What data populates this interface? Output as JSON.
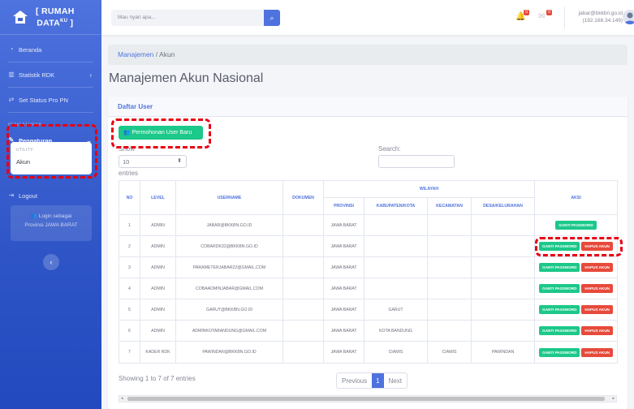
{
  "brand": {
    "line1": "[ RUMAH",
    "line2": "DATA",
    "sup": "KU",
    "line2_end": " ]"
  },
  "sidebar": {
    "items": [
      {
        "label": "Beranda",
        "icon": "gauge-icon"
      },
      {
        "label": "Statistik RDK",
        "icon": "chart-icon"
      },
      {
        "label": "Set Status Pro PN",
        "icon": "exchange-icon"
      }
    ],
    "heading": "PENGATURAN",
    "settings_label": "Pengaturan",
    "utility_heading": "UTILITY:",
    "akun_label": "Akun",
    "logout_label": "Logout",
    "login_line1": "Login sebagai",
    "login_line2": "Provinsi JAWA BARAT"
  },
  "topbar": {
    "search_placeholder": "Mau nyari apa...",
    "bell_badge": "0",
    "mail_badge": "0",
    "user_email": "jabar@bkkbn.go.id",
    "user_ip": "(192.168.34.149)"
  },
  "breadcrumb": {
    "parent": "Manajemen",
    "sep": " / ",
    "current": "Akun"
  },
  "page_title": "Manajemen Akun Nasional",
  "card": {
    "title": "Daftar User",
    "new_button": "Permohonan User Baru",
    "show_label": "Show",
    "show_value": "10",
    "entries_label": "entries",
    "search_label": "Search:"
  },
  "table": {
    "headers": {
      "no": "NO",
      "level": "LEVEL",
      "username": "USERNAME",
      "dokumen": "DOKUMEN",
      "wilayah": "WILAYAH",
      "provinsi": "PROVINSI",
      "kabupaten": "KABUPATEN/KOTA",
      "kecamatan": "KECAMATAN",
      "desa": "DESA/KELURAHAN",
      "aksi": "AKSI"
    },
    "rows": [
      {
        "no": "1",
        "level": "ADMIN",
        "username": "JABAR@BKKBN.GO.ID",
        "dokumen": "",
        "provinsi": "JAWA BARAT",
        "kabupaten": "",
        "kecamatan": "",
        "desa": ""
      },
      {
        "no": "2",
        "level": "ADMIN",
        "username": "COBARDK32@BKKBN.GO.ID",
        "dokumen": "",
        "provinsi": "JAWA BARAT",
        "kabupaten": "",
        "kecamatan": "",
        "desa": ""
      },
      {
        "no": "3",
        "level": "ADMIN",
        "username": "PARAMETERJABAR22@GMAIL.COM",
        "dokumen": "",
        "provinsi": "JAWA BARAT",
        "kabupaten": "",
        "kecamatan": "",
        "desa": ""
      },
      {
        "no": "4",
        "level": "ADMIN",
        "username": "COBAADMINJABAR@GMAIL.COM",
        "dokumen": "",
        "provinsi": "JAWA BARAT",
        "kabupaten": "",
        "kecamatan": "",
        "desa": ""
      },
      {
        "no": "5",
        "level": "ADMIN",
        "username": "GARUT@BKKBN.GO.ID",
        "dokumen": "",
        "provinsi": "JAWA BARAT",
        "kabupaten": "GARUT",
        "kecamatan": "",
        "desa": ""
      },
      {
        "no": "6",
        "level": "ADMIN",
        "username": "ADMINKOTABANDUNG@GMAIL.COM",
        "dokumen": "",
        "provinsi": "JAWA BARAT",
        "kabupaten": "KOTA BANDUNG",
        "kecamatan": "",
        "desa": ""
      },
      {
        "no": "7",
        "level": "KADER RDK",
        "username": "PAWINDAN@BKKBN.GO.ID",
        "dokumen": "",
        "provinsi": "JAWA BARAT",
        "kabupaten": "CIAMIS",
        "kecamatan": "CIAMIS",
        "desa": "PAWINDAN"
      }
    ],
    "btn_ganti": "GANTI PASSWORD",
    "btn_hapus": "HAPUS AKUN"
  },
  "footer": {
    "info": "Showing 1 to 7 of 7 entries",
    "previous": "Previous",
    "page": "1",
    "next": "Next"
  },
  "colors": {
    "primary": "#4e73df",
    "success": "#1cc88a",
    "danger": "#e74a3b",
    "highlight": "#e60012"
  }
}
